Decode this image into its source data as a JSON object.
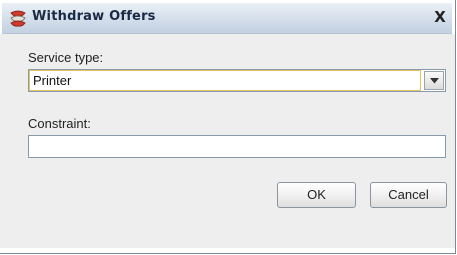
{
  "window": {
    "title": "Withdraw Offers",
    "close_glyph": "X",
    "title_icon": "app-icon"
  },
  "form": {
    "service_type_label": "Service type:",
    "service_type_value": "Printer",
    "constraint_label": "Constraint:",
    "constraint_value": "",
    "constraint_placeholder": ""
  },
  "buttons": {
    "ok_label": "OK",
    "cancel_label": "Cancel"
  },
  "colors": {
    "focus_border": "#e3c25f",
    "titlebar_top": "#ebf0f6",
    "titlebar_bottom": "#c3d1e1",
    "content_background": "#eeeeee"
  }
}
